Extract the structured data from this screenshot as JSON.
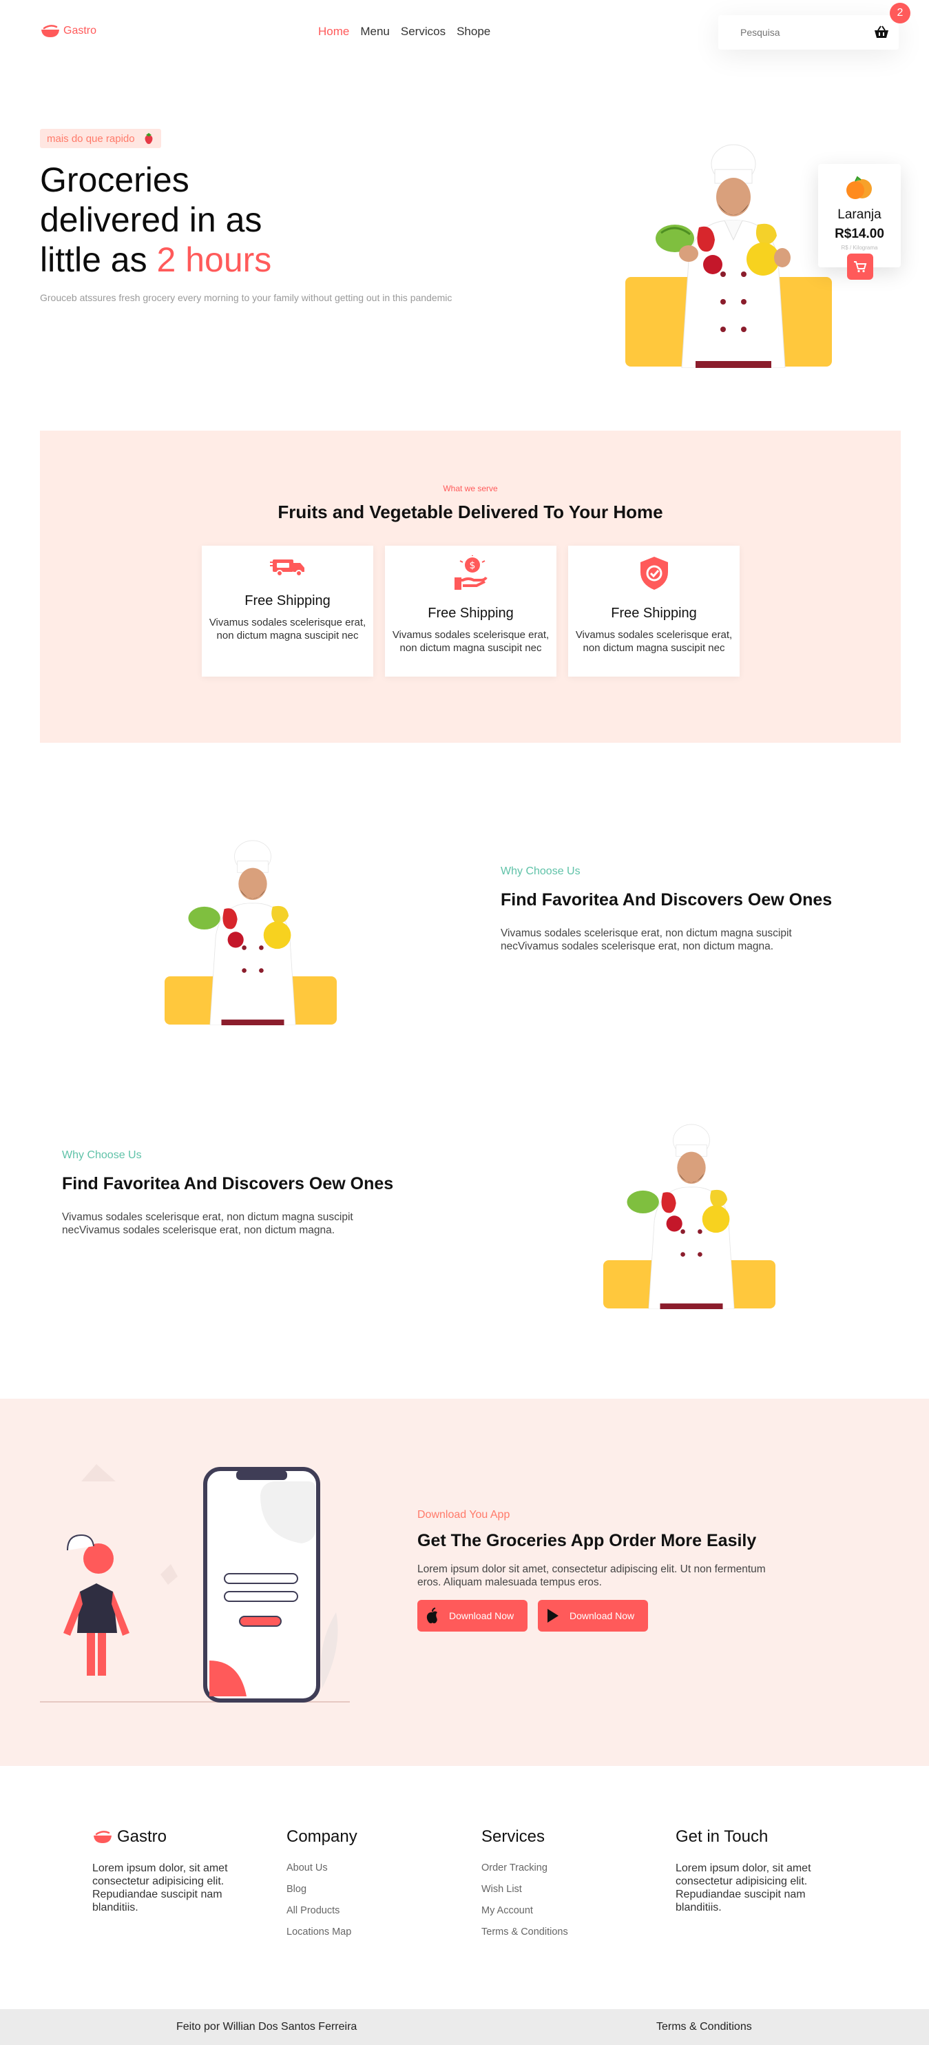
{
  "header": {
    "logo_text": "Gastro",
    "nav": [
      "Home",
      "Menu",
      "Servicos",
      "Shope"
    ],
    "search_placeholder": "Pesquisa",
    "cart_count": "2"
  },
  "hero": {
    "tag": "mais do que rapido",
    "title_line1": "Groceries",
    "title_line2": "delivered in as",
    "title_line3_pre": "little as",
    "title_highlight": "2 hours",
    "subtitle": "Grouceb atssures fresh grocery every morning to your family without getting out in this pandemic",
    "product_card": {
      "name": "Laranja",
      "price": "R$14.00",
      "sub": "R$ / Kilograma"
    }
  },
  "serve": {
    "kicker": "What we serve",
    "title": "Fruits and Vegetable Delivered To Your Home",
    "cards": [
      {
        "icon": "truck-icon",
        "title": "Free Shipping",
        "desc": "Vivamus sodales scelerisque erat, non dictum magna suscipit nec"
      },
      {
        "icon": "money-hand-icon",
        "title": "Free Shipping",
        "desc": "Vivamus sodales scelerisque erat, non dictum magna suscipit nec"
      },
      {
        "icon": "shield-check-icon",
        "title": "Free Shipping",
        "desc": "Vivamus sodales scelerisque erat, non dictum magna suscipit nec"
      }
    ]
  },
  "why1": {
    "kicker": "Why Choose Us",
    "title": "Find Favoritea And Discovers Oew Ones",
    "text": "Vivamus sodales scelerisque erat, non dictum magna suscipit necVivamus sodales scelerisque erat, non dictum magna."
  },
  "why2": {
    "kicker": "Why Choose Us",
    "title": "Find Favoritea And Discovers Oew Ones",
    "text": "Vivamus sodales scelerisque erat, non dictum magna suscipit necVivamus sodales scelerisque erat, non dictum magna."
  },
  "app": {
    "kicker": "Download You App",
    "title": "Get The Groceries App Order More Easily",
    "text": "Lorem ipsum dolor sit amet, consectetur adipiscing elit. Ut non fermentum eros. Aliquam malesuada tempus eros.",
    "btn_apple": "Download Now",
    "btn_play": "Download Now"
  },
  "footer": {
    "brand": "Gastro",
    "brand_text": "Lorem ipsum dolor, sit amet consectetur adipisicing elit. Repudiandae suscipit nam blanditiis.",
    "company_title": "Company",
    "company_links": [
      "About Us",
      "Blog",
      "All Products",
      "Locations Map"
    ],
    "services_title": "Services",
    "services_links": [
      "Order Tracking",
      "Wish List",
      "My Account",
      "Terms & Conditions"
    ],
    "contact_title": "Get in Touch",
    "contact_text": "Lorem ipsum dolor, sit amet consectetur adipisicing elit. Repudiandae suscipit nam blanditiis.",
    "credit": "Feito por Willian Dos Santos Ferreira",
    "terms": "Terms & Conditions"
  },
  "colors": {
    "accent": "#ff5a5a",
    "yellow": "#ffc83d",
    "soft_pink": "#ffece6",
    "teal": "#5fc2a8"
  }
}
